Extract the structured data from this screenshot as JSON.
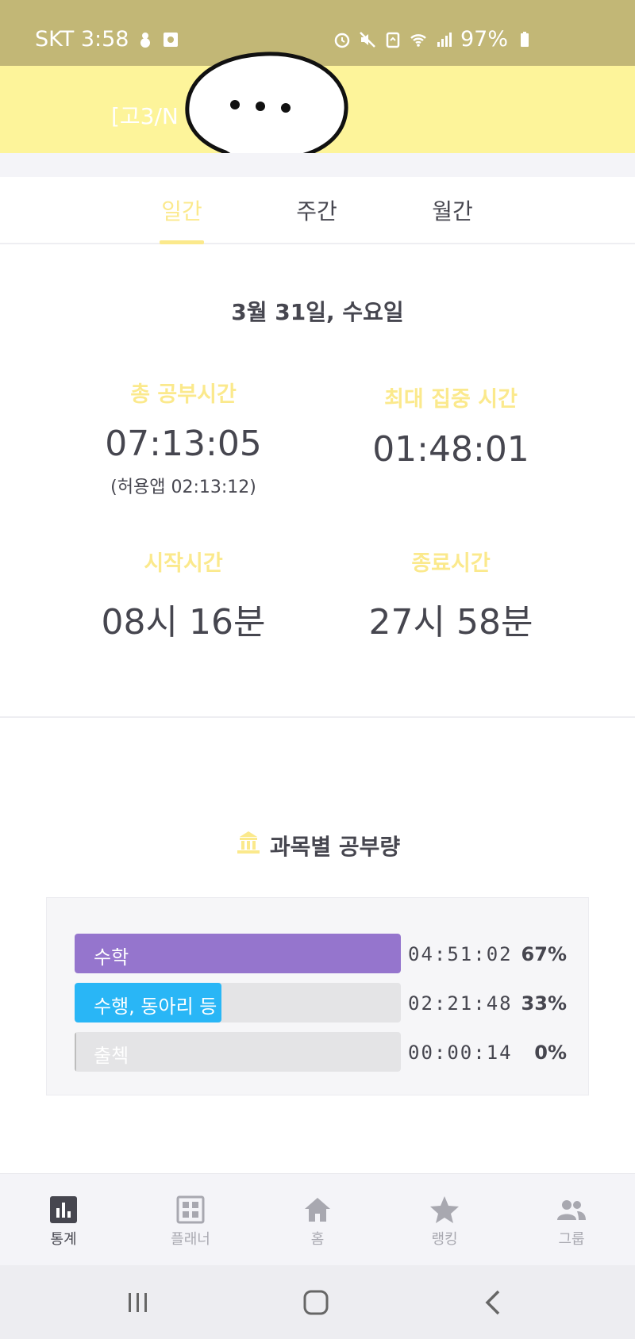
{
  "status_bar": {
    "carrier_time": "SKT 3:58",
    "battery": "97%",
    "icons_left": [
      "snowman-icon",
      "photo-icon"
    ],
    "icons_right": [
      "alarm-icon",
      "mute-icon",
      "recycle-icon",
      "wifi-icon",
      "signal-icon",
      "battery-icon"
    ]
  },
  "header": {
    "title": "[고3/N"
  },
  "tabs": [
    {
      "label": "일간",
      "active": true
    },
    {
      "label": "주간",
      "active": false
    },
    {
      "label": "월간",
      "active": false
    }
  ],
  "daily": {
    "date": "3월 31일, 수요일",
    "total_study": {
      "label": "총 공부시간",
      "value": "07:13:05",
      "sub": "(허용앱  02:13:12)"
    },
    "max_focus": {
      "label": "최대 집중 시간",
      "value": "01:48:01"
    },
    "start_time": {
      "label": "시작시간",
      "value": "08시 16분"
    },
    "end_time": {
      "label": "종료시간",
      "value": "27시 58분"
    }
  },
  "subjects": {
    "title": "과목별 공부량",
    "rows": [
      {
        "name": "수학",
        "time": "04:51:02",
        "percent": "67%",
        "fill_fraction": 1.0,
        "color": "#9575cd"
      },
      {
        "name": "수행, 동아리 등",
        "time": "02:21:48",
        "percent": "33%",
        "fill_fraction": 0.45,
        "color": "#29b6f6"
      },
      {
        "name": "출첵",
        "time": "00:00:14",
        "percent": "0%",
        "fill_fraction": 0.004,
        "color": "#bdbdbd"
      }
    ]
  },
  "bottom_nav": [
    {
      "label": "통계",
      "icon": "stats-icon",
      "active": true
    },
    {
      "label": "플래너",
      "icon": "planner-icon",
      "active": false
    },
    {
      "label": "홈",
      "icon": "home-icon",
      "active": false
    },
    {
      "label": "랭킹",
      "icon": "star-icon",
      "active": false
    },
    {
      "label": "그룹",
      "icon": "group-icon",
      "active": false
    }
  ],
  "colors": {
    "status_bar": "#c2b776",
    "header": "#fdf49a",
    "accent": "#fbe98c",
    "text": "#46464f"
  }
}
